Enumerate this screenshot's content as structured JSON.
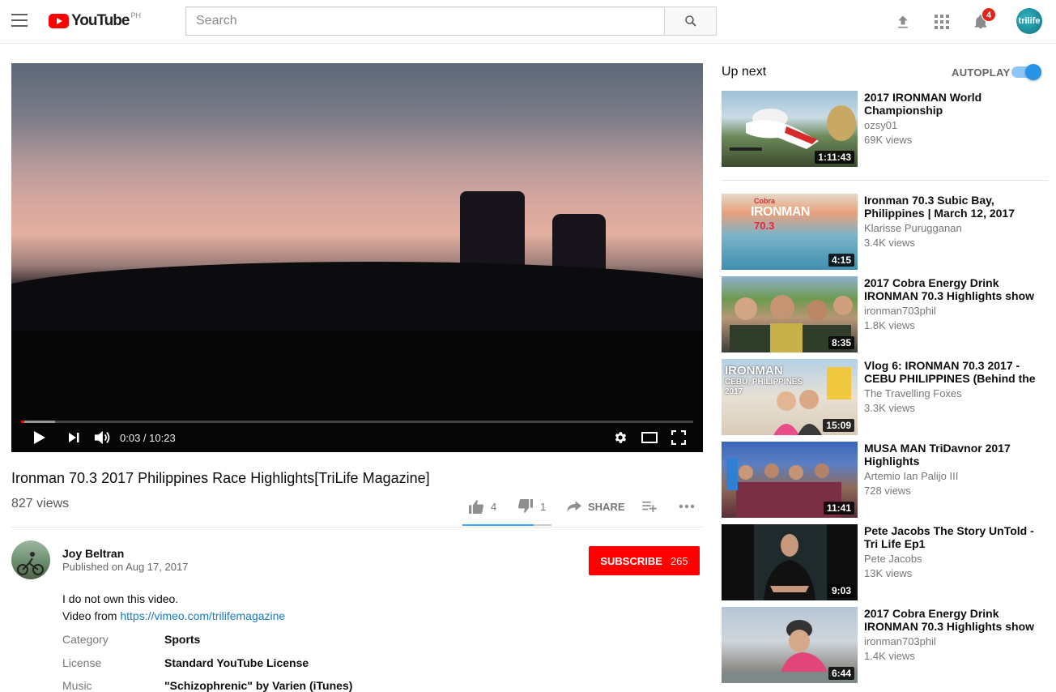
{
  "header": {
    "logo_text": "YouTube",
    "logo_region": "PH",
    "search_placeholder": "Search",
    "notification_count": "4",
    "account_initials": "trilife"
  },
  "player": {
    "time_current": "0:03",
    "time_separator": " / ",
    "time_total": "10:23",
    "played_fraction": 0.005,
    "buffered_fraction": 0.05
  },
  "video": {
    "title": "Ironman 70.3 2017 Philippines Race Highlights[TriLife Magazine]",
    "views": "827 views",
    "likes": "4",
    "dislikes": "1",
    "share_label": "SHARE",
    "like_ratio": 0.8
  },
  "owner": {
    "name": "Joy Beltran",
    "published": "Published on Aug 17, 2017",
    "subscribe_label": "SUBSCRIBE",
    "subscriber_count": "265"
  },
  "description": {
    "line1": "I do not own this video.",
    "line2_prefix": "Video from ",
    "link_text": "https://vimeo.com/trilifemagazine",
    "meta": [
      {
        "label": "Category",
        "value": "Sports"
      },
      {
        "label": "License",
        "value": "Standard YouTube License"
      },
      {
        "label": "Music",
        "value": "\"Schizophrenic\" by Varien (iTunes)"
      }
    ]
  },
  "sidebar": {
    "up_next_label": "Up next",
    "autoplay_label": "AUTOPLAY",
    "autoplay_on": true,
    "items": [
      {
        "title": "2017 IRONMAN World Championship",
        "channel": "ozsy01",
        "views": "69K views",
        "duration": "1:11:43"
      },
      {
        "title": "Ironman 70.3 Subic Bay, Philippines | March 12, 2017",
        "channel": "Klarisse Purugganan",
        "views": "3.4K views",
        "duration": "4:15"
      },
      {
        "title": "2017 Cobra Energy Drink IRONMAN 70.3 Highlights show",
        "channel": "ironman703phil",
        "views": "1.8K views",
        "duration": "8:35"
      },
      {
        "title": "Vlog 6: IRONMAN 70.3 2017 - CEBU PHILIPPINES (Behind the",
        "channel": "The Travelling Foxes",
        "views": "3.3K views",
        "duration": "15:09"
      },
      {
        "title": "MUSA MAN TriDavnor 2017 Highlights",
        "channel": "Artemio Ian Palijo III",
        "views": "728 views",
        "duration": "11:41"
      },
      {
        "title": "Pete Jacobs The Story UnTold - Tri Life Ep1",
        "channel": "Pete Jacobs",
        "views": "13K views",
        "duration": "9:03"
      },
      {
        "title": "2017 Cobra Energy Drink IRONMAN 70.3 Highlights show",
        "channel": "ironman703phil",
        "views": "1.4K views",
        "duration": "6:44"
      }
    ],
    "thumb_texts": {
      "subic_brand": "Cobra",
      "subic_logo": "IRONMAN",
      "subic_num": "70.3",
      "cebu_logo": "IRONMAN",
      "cebu_place": "CEBU, PHILIPPINES",
      "cebu_year": "2017"
    }
  },
  "colors": {
    "brand_red": "#ff0000",
    "link_blue": "#167ac6",
    "toggle_blue": "#2793e6"
  }
}
